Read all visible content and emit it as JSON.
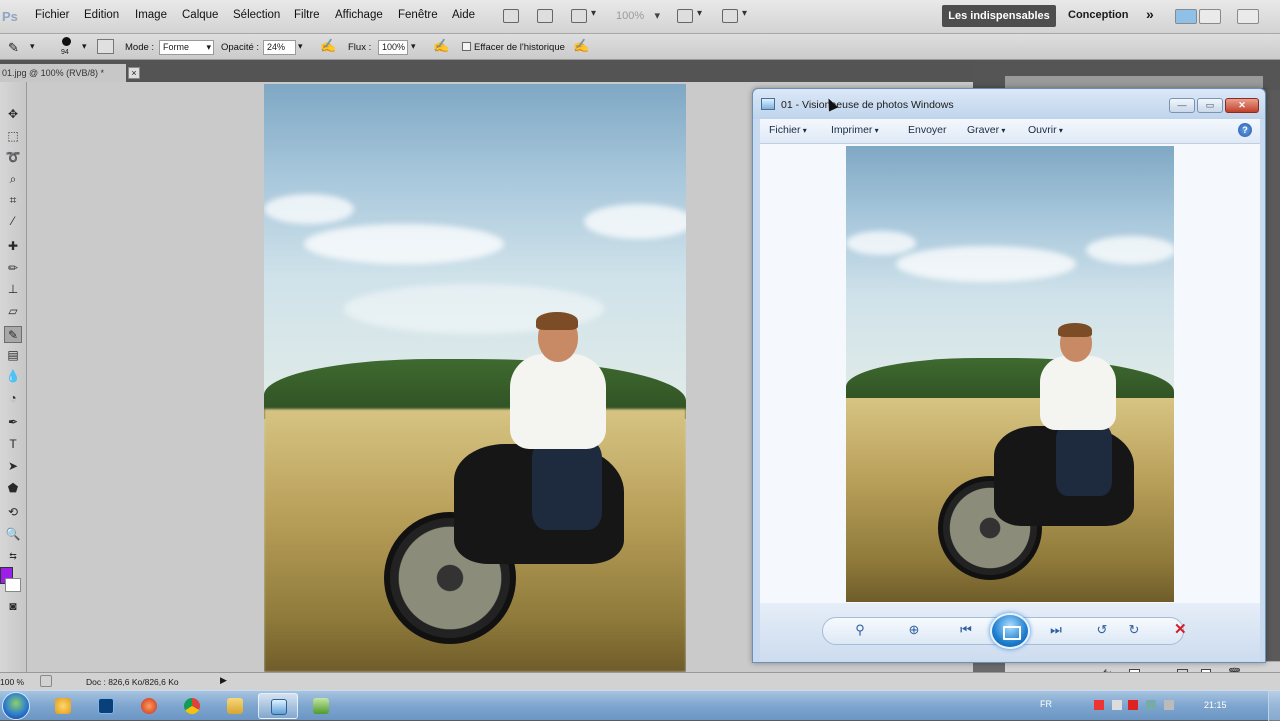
{
  "photoshop": {
    "logo": "Ps",
    "menu": [
      "Fichier",
      "Edition",
      "Image",
      "Calque",
      "Sélection",
      "Filtre",
      "Affichage",
      "Fenêtre",
      "Aide"
    ],
    "zoom": "100%",
    "workspace_active": "Les indispensables",
    "workspace_other": "Conception",
    "workspace_more": "»"
  },
  "options": {
    "brush_size": "94",
    "mode_label": "Mode :",
    "mode_value": "Forme",
    "opacity_label": "Opacité :",
    "opacity_value": "24%",
    "flow_label": "Flux :",
    "flow_value": "100%",
    "history_label": "Effacer de l'historique"
  },
  "document": {
    "tab_title": "01.jpg @ 100% (RVB/8) *",
    "tab_close": "×",
    "status_zoom": "100 %",
    "status_doc": "Doc : 826,6 Ko/826,6 Ko"
  },
  "foreground_color": "#9b1fe8",
  "viewer": {
    "title": "01 - Visionneuse de photos Windows",
    "menu": [
      {
        "label": "Fichier",
        "dropdown": true
      },
      {
        "label": "Imprimer",
        "dropdown": true
      },
      {
        "label": "Envoyer",
        "dropdown": false
      },
      {
        "label": "Graver",
        "dropdown": true
      },
      {
        "label": "Ouvrir",
        "dropdown": true
      }
    ],
    "help": "?",
    "minimize": "—",
    "maximize": "▭",
    "close": "✕",
    "controls": {
      "zoom": "⚲",
      "fit": "⊕",
      "prev": "⏮",
      "next": "⏭",
      "rotate_ccw": "↺",
      "rotate_cw": "↻",
      "delete": "✕"
    }
  },
  "taskbar": {
    "lang": "FR",
    "time": "21:15"
  }
}
